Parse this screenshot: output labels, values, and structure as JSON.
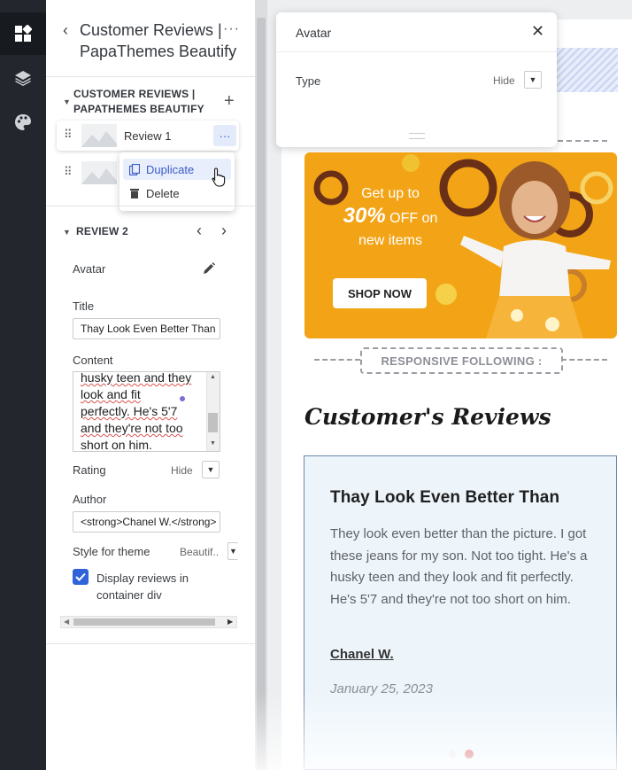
{
  "rail": {
    "items": [
      {
        "icon": "sections-icon",
        "active": true
      },
      {
        "icon": "layers-icon",
        "active": false
      },
      {
        "icon": "theme-palette-icon",
        "active": false
      }
    ]
  },
  "panel": {
    "title": "Customer Reviews | PapaThemes Beautify",
    "block_section_title": "CUSTOMER REVIEWS | PAPATHEMES BEAUTIFY",
    "blocks": [
      {
        "label": "Review 1"
      },
      {
        "label": ""
      }
    ],
    "context_menu": {
      "duplicate": "Duplicate",
      "delete": "Delete"
    },
    "review_section_title": "REVIEW 2",
    "fields": {
      "avatar_label": "Avatar",
      "title_label": "Title",
      "title_value": "Thay Look Even Better Than",
      "content_label": "Content",
      "content_lines": [
        "husky teen and they",
        "look and fit",
        "perfectly. He's 5'7",
        "and they're not too",
        "short on him."
      ],
      "rating_label": "Rating",
      "rating_value": "Hide",
      "author_label": "Author",
      "author_value": "<strong>Chanel W.</strong>",
      "style_label": "Style for theme",
      "style_value": "Beautif..",
      "display_label": "Display reviews in container div",
      "display_checked": true
    }
  },
  "popover": {
    "title": "Avatar",
    "type_label": "Type",
    "type_value": "Hide"
  },
  "preview": {
    "banner": {
      "line1": "Get up to",
      "big": "30%",
      "line2": " OFF on",
      "line3": "new items",
      "button": "SHOP NOW"
    },
    "responsive_tag": "RESPONSIVE FOLLOWING :",
    "reviews_heading": "Customer's Reviews",
    "review": {
      "title": "Thay Look Even Better Than",
      "body": "They look even better than the picture. I got these jeans for my son. Not too tight. He's a husky teen and they look and fit perfectly. He's 5'7 and they're not too short on him.",
      "author": "Chanel W.",
      "date": "January 25, 2023"
    }
  },
  "colors": {
    "rail": "#23272d",
    "accent": "#2e63d9",
    "banner": "#f2a416",
    "card_bg": "#edf5fb",
    "card_border": "#6b87a8"
  }
}
